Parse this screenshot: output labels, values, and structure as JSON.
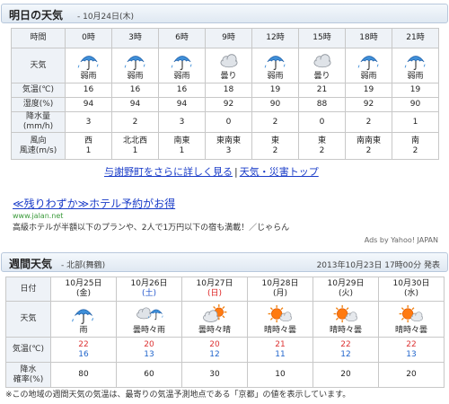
{
  "tomorrow": {
    "title": "明日の天気",
    "date": " - 10月24日(木)",
    "row_labels": {
      "time": "時間",
      "weather": "天気",
      "temp": "気温(℃)",
      "humidity": "湿度(%)",
      "precip": "降水量(mm/h)",
      "wind_dir": "風向",
      "wind_speed": "風速(m/s)"
    },
    "columns": [
      {
        "time": "0時",
        "icon": "umbrella-rain-icon",
        "weather": "弱雨",
        "temp": "16",
        "humidity": "94",
        "precip": "3",
        "wind_dir": "西",
        "wind_speed": "1"
      },
      {
        "time": "3時",
        "icon": "umbrella-rain-icon",
        "weather": "弱雨",
        "temp": "16",
        "humidity": "94",
        "precip": "2",
        "wind_dir": "北北西",
        "wind_speed": "1"
      },
      {
        "time": "6時",
        "icon": "umbrella-rain-icon",
        "weather": "弱雨",
        "temp": "16",
        "humidity": "94",
        "precip": "3",
        "wind_dir": "南東",
        "wind_speed": "1"
      },
      {
        "time": "9時",
        "icon": "cloud-icon",
        "weather": "曇り",
        "temp": "18",
        "humidity": "92",
        "precip": "0",
        "wind_dir": "東南東",
        "wind_speed": "3"
      },
      {
        "time": "12時",
        "icon": "umbrella-rain-icon",
        "weather": "弱雨",
        "temp": "19",
        "humidity": "90",
        "precip": "2",
        "wind_dir": "東",
        "wind_speed": "2"
      },
      {
        "time": "15時",
        "icon": "cloud-icon",
        "weather": "曇り",
        "temp": "21",
        "humidity": "88",
        "precip": "0",
        "wind_dir": "東",
        "wind_speed": "2"
      },
      {
        "time": "18時",
        "icon": "umbrella-rain-icon",
        "weather": "弱雨",
        "temp": "19",
        "humidity": "92",
        "precip": "2",
        "wind_dir": "南南東",
        "wind_speed": "2"
      },
      {
        "time": "21時",
        "icon": "umbrella-rain-icon",
        "weather": "弱雨",
        "temp": "19",
        "humidity": "90",
        "precip": "1",
        "wind_dir": "南",
        "wind_speed": "2"
      }
    ]
  },
  "links": {
    "detail": "与謝野町をさらに詳しく見る",
    "separator": "|",
    "disaster": "天気・災害トップ"
  },
  "ad": {
    "title": "≪残りわずか≫ホテル予約がお得",
    "url": "www.jalan.net",
    "desc": "高級ホテルが半額以下のプランや、2人で1万円以下の宿も満載！／じゃらん",
    "by": "Ads by Yahoo! JAPAN"
  },
  "weekly": {
    "title": "週間天気",
    "region": " - 北部(舞鶴)",
    "issued": "2013年10月23日 17時00分 発表",
    "row_labels": {
      "date": "日付",
      "weather": "天気",
      "temp": "気温(℃)",
      "precip_prob_1": "降水",
      "precip_prob_2": "確率(%)"
    },
    "days": [
      {
        "date": "10月25日",
        "dow": "(金)",
        "dow_type": "weekday",
        "icon": "umbrella-rain-icon",
        "weather": "雨",
        "high": "22",
        "low": "16",
        "prob": "80"
      },
      {
        "date": "10月26日",
        "dow": "(土)",
        "dow_type": "sat",
        "icon": "cloud-rain-icon",
        "weather": "曇時々雨",
        "high": "20",
        "low": "13",
        "prob": "60"
      },
      {
        "date": "10月27日",
        "dow": "(日)",
        "dow_type": "sun",
        "icon": "cloud-sun-icon",
        "weather": "曇時々晴",
        "high": "20",
        "low": "12",
        "prob": "30"
      },
      {
        "date": "10月28日",
        "dow": "(月)",
        "dow_type": "weekday",
        "icon": "sun-cloud-icon",
        "weather": "晴時々曇",
        "high": "21",
        "low": "11",
        "prob": "10"
      },
      {
        "date": "10月29日",
        "dow": "(火)",
        "dow_type": "weekday",
        "icon": "sun-cloud-icon",
        "weather": "晴時々曇",
        "high": "22",
        "low": "12",
        "prob": "20"
      },
      {
        "date": "10月30日",
        "dow": "(水)",
        "dow_type": "weekday",
        "icon": "sun-cloud-icon",
        "weather": "晴時々曇",
        "high": "22",
        "low": "13",
        "prob": "20"
      }
    ]
  },
  "footnote": "※この地域の週間天気の気温は、最寄りの気温予測地点である「京都」の値を表示しています。",
  "colors": {
    "high_temp": "#dd3333",
    "low_temp": "#2266cc",
    "saturday": "#2255cc",
    "sunday": "#dd2222",
    "link": "#1a3cc8"
  }
}
